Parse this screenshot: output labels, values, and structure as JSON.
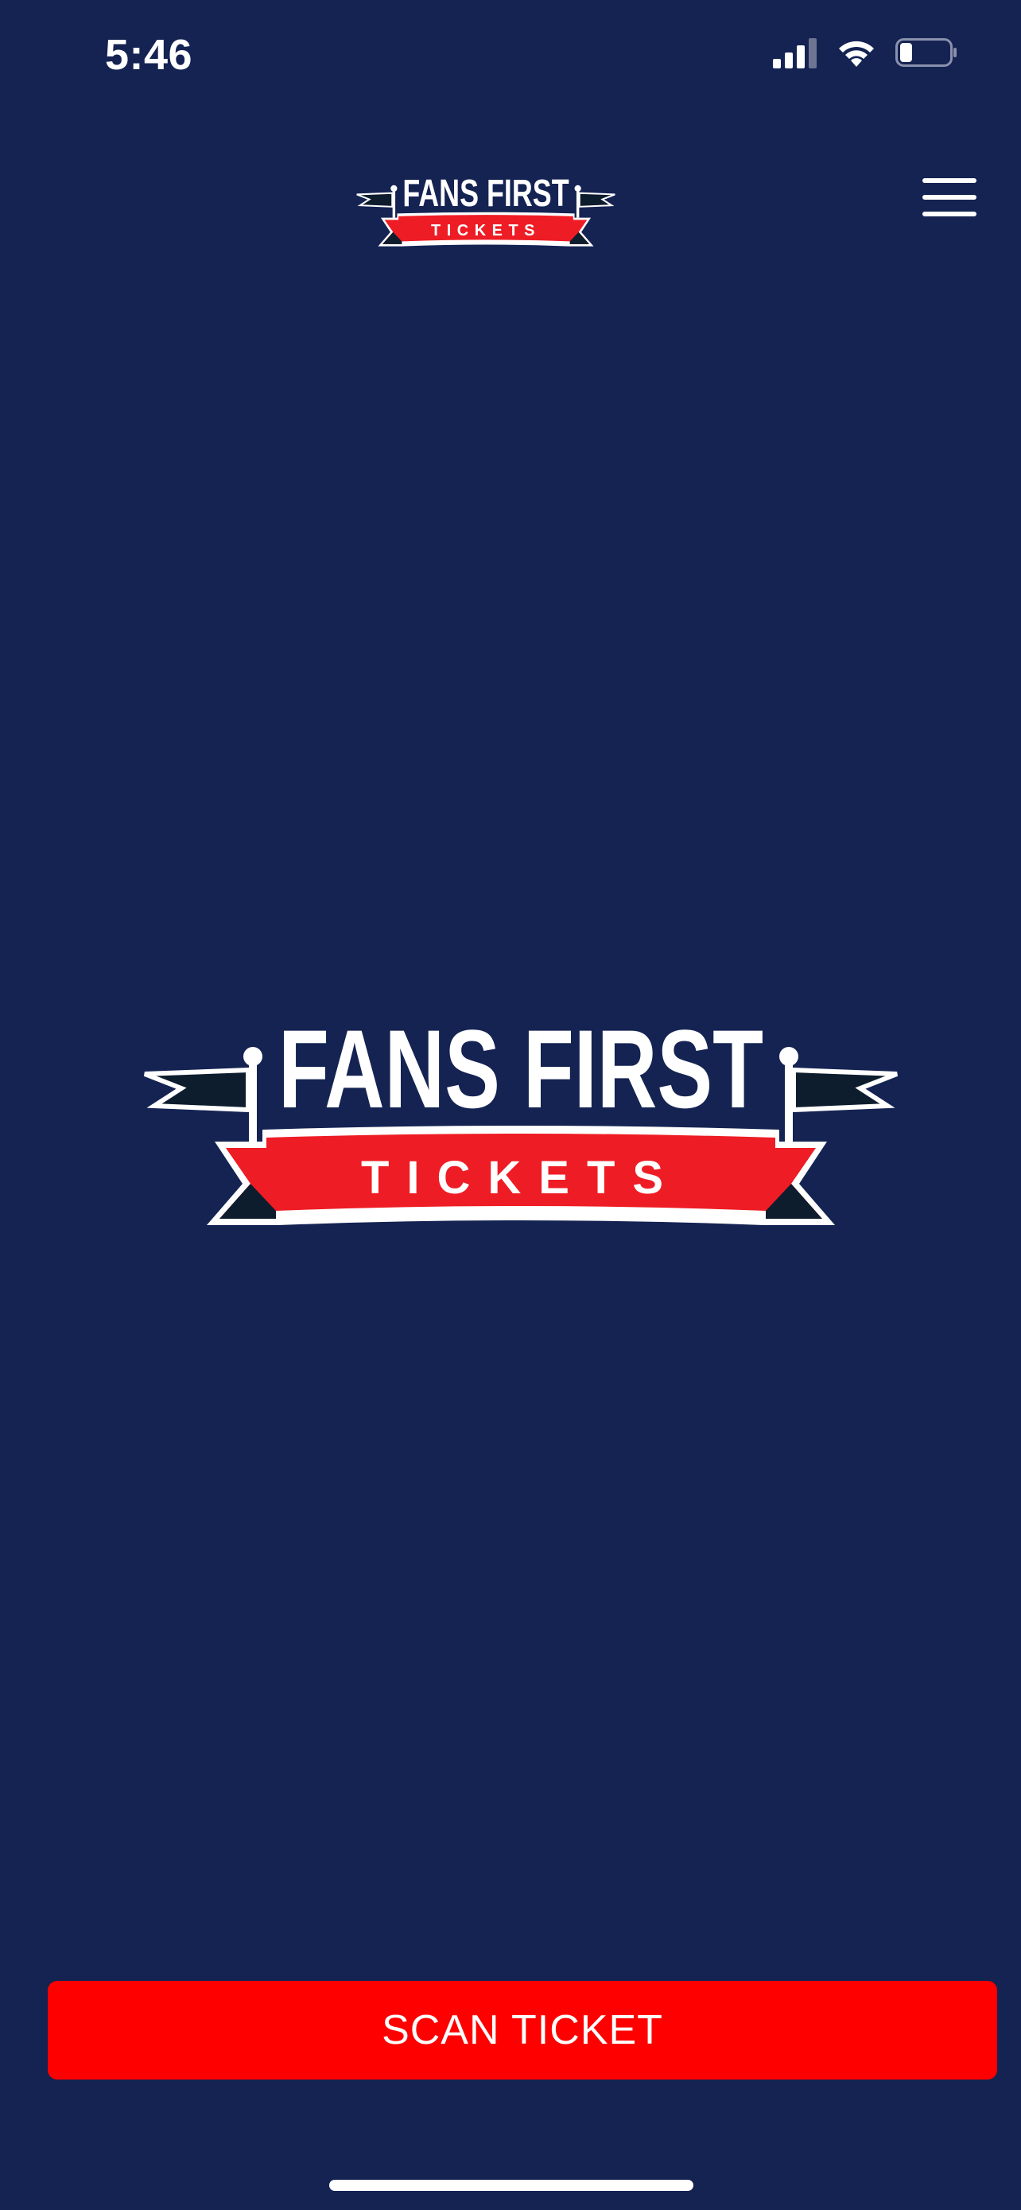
{
  "status_bar": {
    "time": "5:46",
    "signal_icon": "cellular-signal-icon",
    "wifi_icon": "wifi-icon",
    "battery_icon": "battery-icon",
    "battery_level": 0.25
  },
  "header": {
    "logo_top_text": "FANS FIRST",
    "logo_bottom_text": "TICKETS",
    "menu_icon": "hamburger-menu-icon"
  },
  "main": {
    "logo_top_text": "FANS FIRST",
    "logo_bottom_text": "TICKETS"
  },
  "footer": {
    "scan_button_label": "SCAN TICKET"
  },
  "colors": {
    "background": "#142352",
    "accent_red": "#ff0000",
    "banner_red": "#ee1c24",
    "pennant_dark": "#0d1d2e",
    "text": "#ffffff"
  }
}
